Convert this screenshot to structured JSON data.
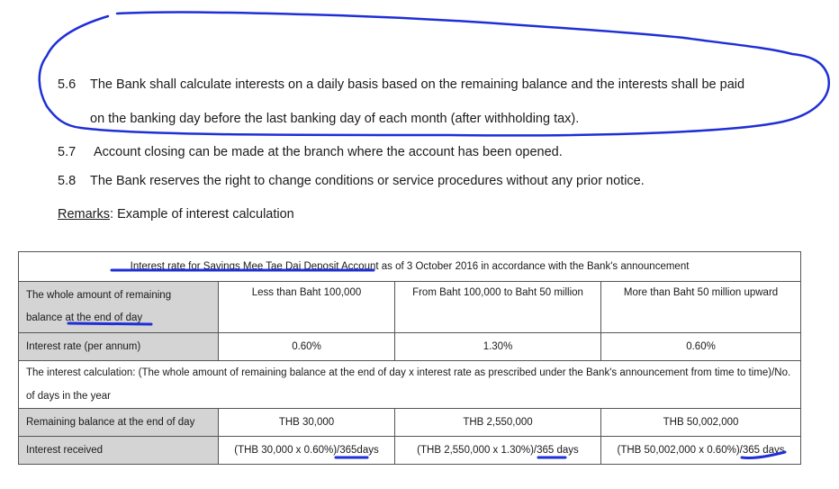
{
  "clauses": [
    {
      "number": "5.6",
      "text_line1": "The Bank shall calculate interests on a daily basis based on the remaining balance and the interests shall be paid",
      "text_line2": "on the banking day before the last banking day of each month (after withholding tax)."
    },
    {
      "number": "5.7",
      "text": "Account closing can be made at the branch where the account has been opened."
    },
    {
      "number": "5.8",
      "text": "The Bank reserves the right to change conditions or service procedures without any prior notice."
    }
  ],
  "remarks": {
    "label": "Remarks",
    "text": ": Example of interest calculation"
  },
  "table": {
    "title_part1": "Interest rate for Savings Mee Tae Dai Deposit Account",
    "title_part2": " as of 3 October 2016 in accordance with the Bank's announcement",
    "balance_row": {
      "label_line1": "The whole amount of remaining",
      "label_line2a": "balance ",
      "label_line2b": "at the end of day",
      "tiers": [
        "Less than Baht 100,000",
        "From Baht 100,000 to Baht 50 million",
        "More than Baht 50 million upward"
      ]
    },
    "rate_row": {
      "label": "Interest rate (per annum)",
      "values": [
        "0.60%",
        "1.30%",
        "0.60%"
      ]
    },
    "calculation_note": "The interest calculation: (The whole amount of remaining balance at the end of day x interest rate as prescribed under the Bank's announcement from time to time)/No. of days in the year",
    "remaining_row": {
      "label": "Remaining balance at the end of day",
      "values": [
        "THB 30,000",
        "THB 2,550,000",
        "THB 50,002,000"
      ]
    },
    "received_row": {
      "label": "Interest received",
      "values": [
        "(THB 30,000 x 0.60%)/365days",
        "(THB 2,550,000 x 1.30%)/365 days",
        "(THB 50,002,000 x 0.60%)/365 days"
      ]
    }
  },
  "annotation_color": "#1f2fd6"
}
